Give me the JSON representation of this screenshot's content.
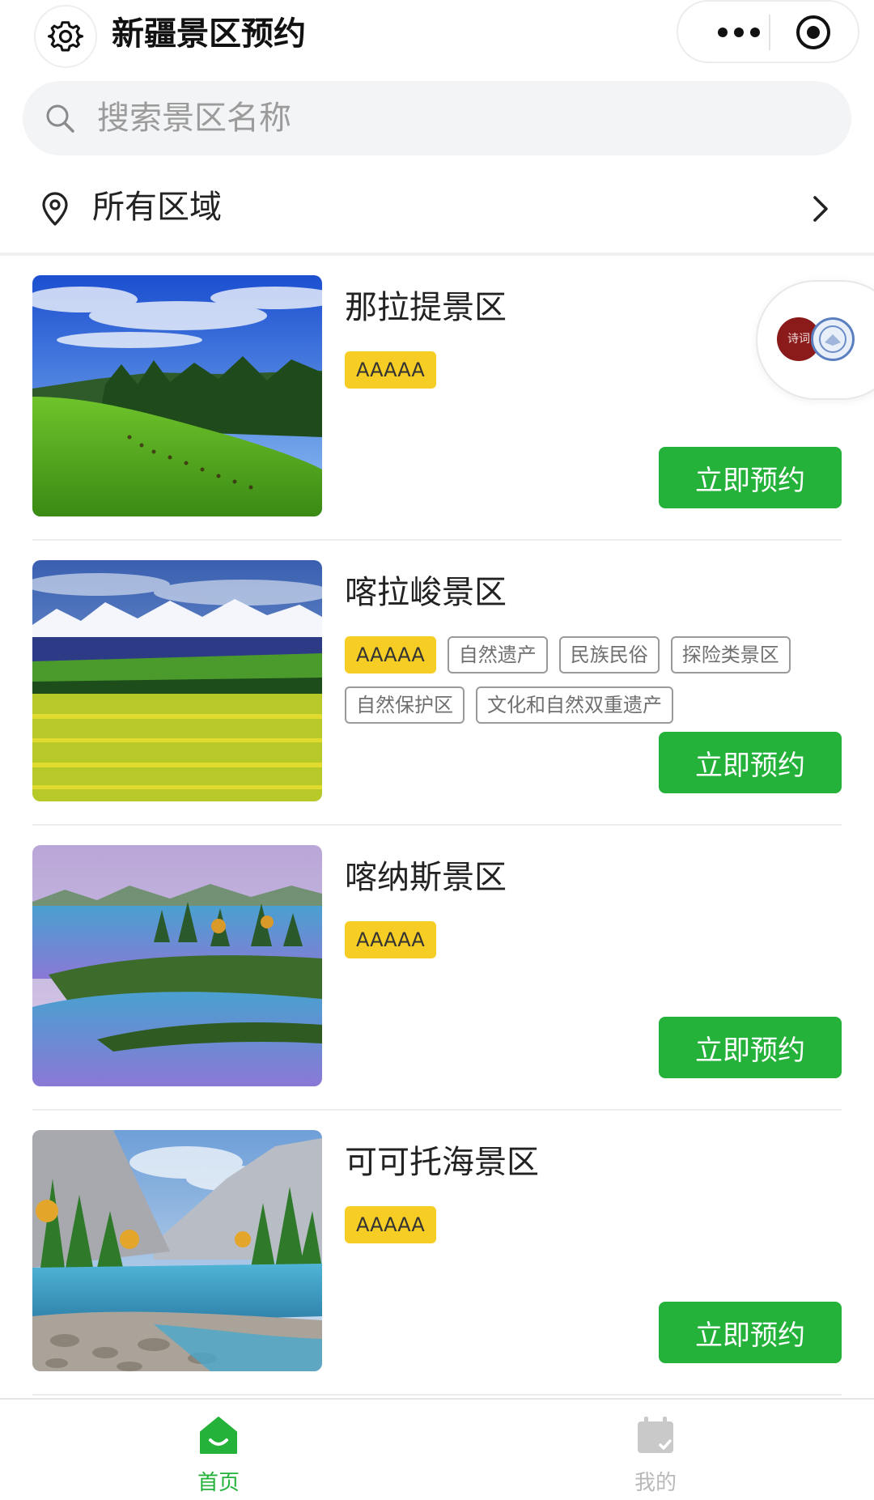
{
  "header": {
    "title": "新疆景区预约",
    "settings_icon": "gear-icon",
    "more_icon": "more-dots-icon",
    "close_icon": "target-close-icon"
  },
  "search": {
    "placeholder": "搜索景区名称",
    "icon": "search-icon"
  },
  "region": {
    "label": "所有区域",
    "icon": "location-pin-icon"
  },
  "floating_avatar": {
    "seal_text": "诗词"
  },
  "scenic_spots": [
    {
      "name": "那拉提景区",
      "grade": "AAAAA",
      "tags": [],
      "button": "立即预约"
    },
    {
      "name": "喀拉峻景区",
      "grade": "AAAAA",
      "tags": [
        "自然遗产",
        "民族民俗",
        "探险类景区",
        "自然保护区",
        "文化和自然双重遗产"
      ],
      "button": "立即预约"
    },
    {
      "name": "喀纳斯景区",
      "grade": "AAAAA",
      "tags": [],
      "button": "立即预约"
    },
    {
      "name": "可可托海景区",
      "grade": "AAAAA",
      "tags": [],
      "button": "立即预约"
    }
  ],
  "tabbar": {
    "home": {
      "label": "首页",
      "icon": "home-icon"
    },
    "mine": {
      "label": "我的",
      "icon": "calendar-icon"
    }
  },
  "colors": {
    "accent_green": "#25b23b",
    "grade_yellow": "#f5cd24"
  }
}
